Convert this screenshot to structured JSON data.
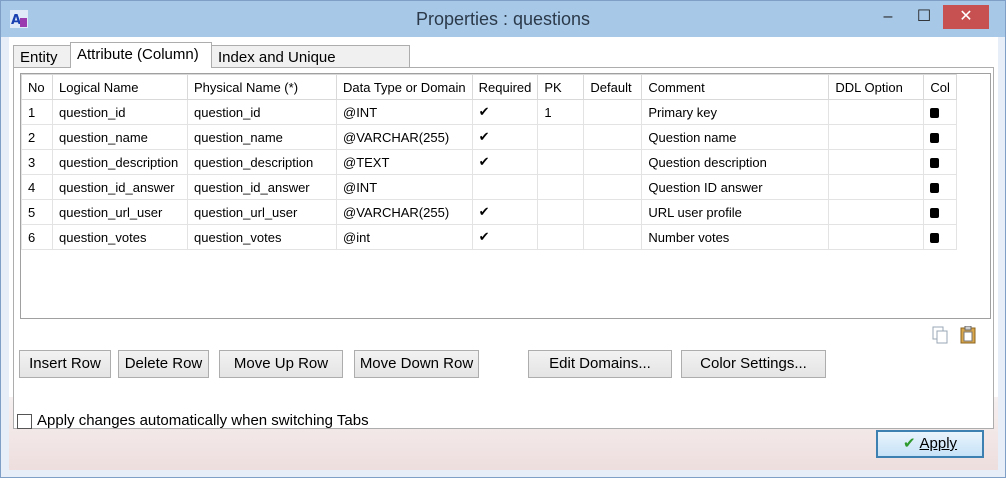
{
  "window": {
    "title": "Properties : questions",
    "app_icon": "app-icon",
    "controls": {
      "minimize": "–",
      "maximize": "☐",
      "close": "✕"
    }
  },
  "tabs": [
    {
      "label": "Entity"
    },
    {
      "label": "Attribute (Column)"
    },
    {
      "label": "Index and Unique Constraint"
    }
  ],
  "grid": {
    "columns": [
      "No",
      "Logical Name",
      "Physical Name (*)",
      "Data Type or Domain",
      "Required",
      "PK",
      "Default",
      "Comment",
      "DDL Option",
      "Col"
    ],
    "rows": [
      {
        "no": "1",
        "logical": "question_id",
        "physical": "question_id",
        "type": "@INT",
        "required": "✔",
        "pk": "1",
        "default": "",
        "comment": "Primary key",
        "ddl": ""
      },
      {
        "no": "2",
        "logical": "question_name",
        "physical": "question_name",
        "type": "@VARCHAR(255)",
        "required": "✔",
        "pk": "",
        "default": "",
        "comment": "Question name",
        "ddl": ""
      },
      {
        "no": "3",
        "logical": "question_description",
        "physical": "question_description",
        "type": "@TEXT",
        "required": "✔",
        "pk": "",
        "default": "",
        "comment": "Question description",
        "ddl": ""
      },
      {
        "no": "4",
        "logical": "question_id_answer",
        "physical": "question_id_answer",
        "type": "@INT",
        "required": "",
        "pk": "",
        "default": "",
        "comment": "Question ID answer",
        "ddl": ""
      },
      {
        "no": "5",
        "logical": "question_url_user",
        "physical": "question_url_user",
        "type": "@VARCHAR(255)",
        "required": "✔",
        "pk": "",
        "default": "",
        "comment": "URL user profile",
        "ddl": ""
      },
      {
        "no": "6",
        "logical": "question_votes",
        "physical": "question_votes",
        "type": "@int",
        "required": "✔",
        "pk": "",
        "default": "",
        "comment": "Number votes",
        "ddl": ""
      }
    ],
    "row_color": "#000000"
  },
  "toolbar_icons": [
    "copy-icon",
    "paste-icon"
  ],
  "buttons": {
    "insert_row": "Insert Row",
    "delete_row": "Delete Row",
    "move_up": "Move Up Row",
    "move_down": "Move Down Row",
    "edit_domains": "Edit Domains...",
    "color_settings": "Color Settings..."
  },
  "apply_auto": {
    "label": "Apply changes automatically when switching Tabs",
    "checked": false
  },
  "apply_button": {
    "label": "Apply"
  }
}
